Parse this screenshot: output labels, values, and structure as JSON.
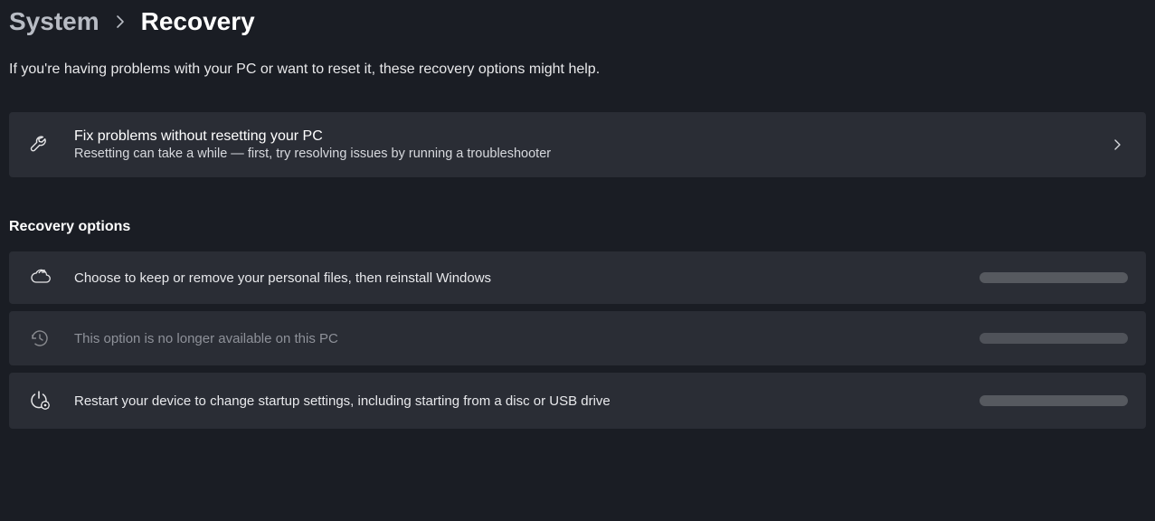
{
  "breadcrumb": {
    "parent": "System",
    "current": "Recovery"
  },
  "intro": "If you're having problems with your PC or want to reset it, these recovery options might help.",
  "fix_card": {
    "title": "Fix problems without resetting your PC",
    "subtitle": "Resetting can take a while — first, try resolving issues by running a troubleshooter"
  },
  "section_title": "Recovery options",
  "options": {
    "reset": "Choose to keep or remove your personal files, then reinstall Windows",
    "goback": "This option is no longer available on this PC",
    "advanced": "Restart your device to change startup settings, including starting from a disc or USB drive"
  }
}
